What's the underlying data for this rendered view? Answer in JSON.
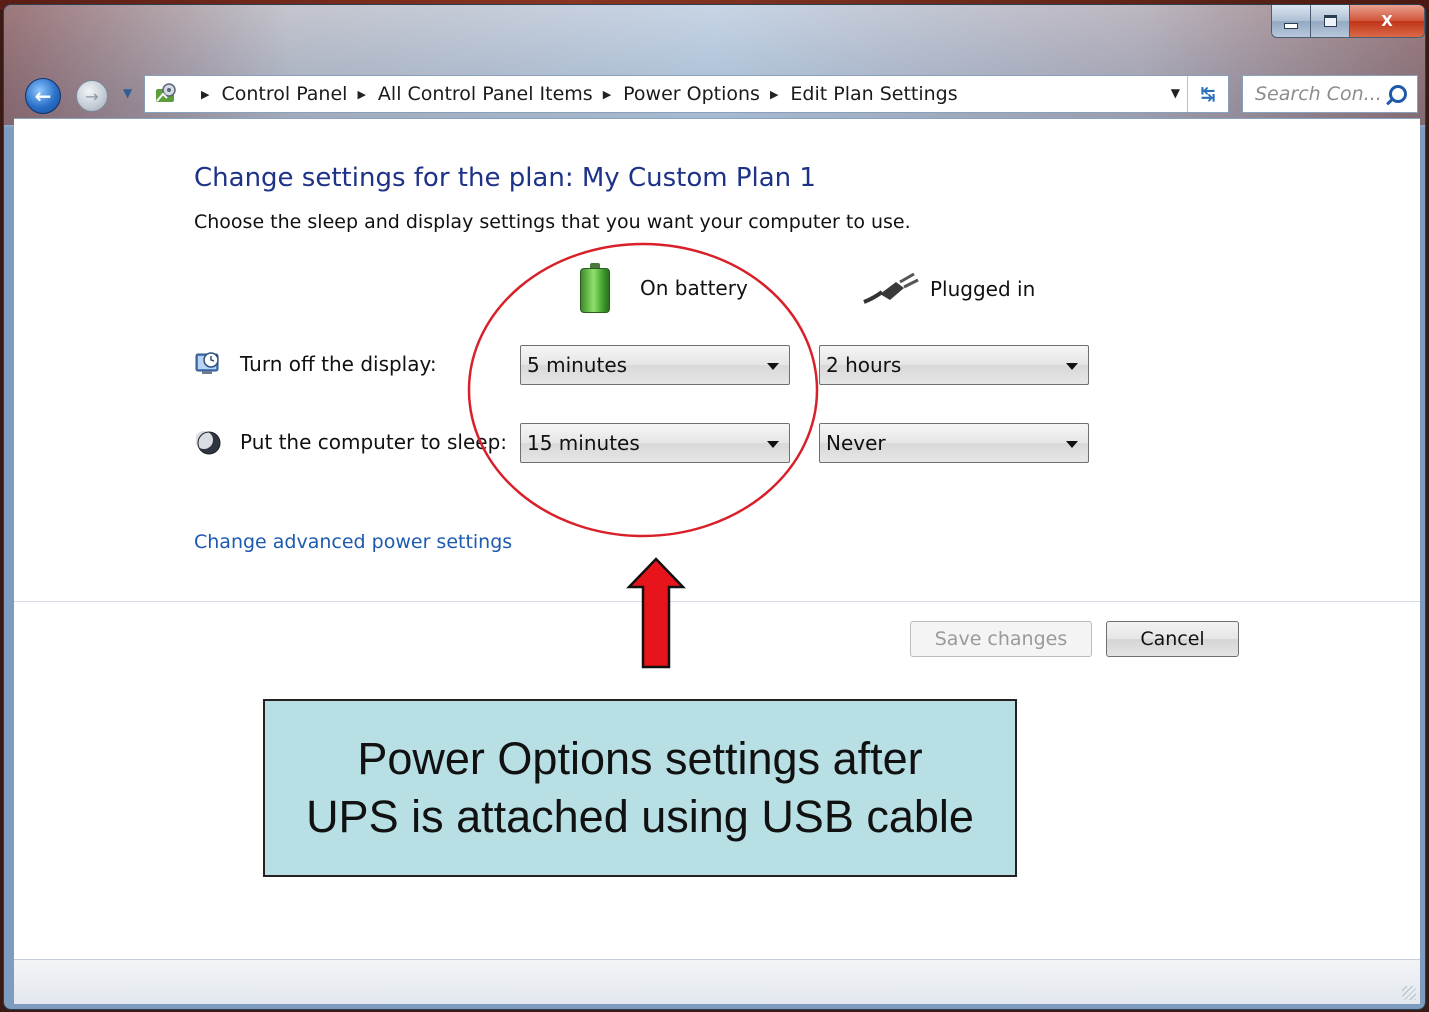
{
  "window": {
    "controls": {
      "minimize_icon": "minimize-icon",
      "maximize_icon": "maximize-icon",
      "close_label": "X"
    }
  },
  "address_bar": {
    "breadcrumbs": [
      "Control Panel",
      "All Control Panel Items",
      "Power Options",
      "Edit Plan Settings"
    ],
    "search_placeholder": "Search Con..."
  },
  "page": {
    "title": "Change settings for the plan: My Custom Plan 1",
    "subtitle": "Choose the sleep and display settings that you want your computer to use.",
    "columns": {
      "battery": "On battery",
      "plugged": "Plugged in"
    },
    "rows": [
      {
        "label": "Turn off the display:",
        "battery": "5 minutes",
        "plugged": "2 hours",
        "icon": "display-timer-icon"
      },
      {
        "label": "Put the computer to sleep:",
        "battery": "15 minutes",
        "plugged": "Never",
        "icon": "sleep-moon-icon"
      }
    ],
    "advanced_link": "Change advanced power settings",
    "buttons": {
      "save": "Save changes",
      "cancel": "Cancel"
    }
  },
  "annotation": {
    "line1": "Power Options settings after",
    "line2": "UPS is attached using USB cable",
    "highlight_color": "#d8202a",
    "callout_color": "#b7dfe4"
  },
  "colors": {
    "title_blue": "#1e3287",
    "link_blue": "#1c5ab0"
  }
}
